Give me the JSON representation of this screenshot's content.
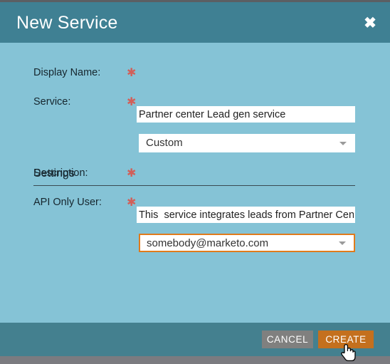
{
  "dialog": {
    "title": "New Service",
    "close_icon": "close-icon"
  },
  "colors": {
    "titlebar": "#3f8093",
    "body": "#85c3d6",
    "footer": "#44808f",
    "required_star": "#d1605a",
    "focus_border": "#e07b1c",
    "cancel_button": "#80807f",
    "create_button": "#c4701e",
    "bottom_strip": "#7b7b80"
  },
  "form": {
    "required_marker": "✱",
    "fields": [
      {
        "label": "Display Name:",
        "type": "text",
        "value": "Partner center Lead gen service",
        "placeholder": "",
        "required": true,
        "focused": false
      },
      {
        "label": "Service:",
        "type": "select",
        "value": "Custom",
        "required": true,
        "focused": false,
        "caret_icon": "chevron-down-icon"
      },
      {
        "label": "Description:",
        "type": "text",
        "value": "This  service integrates leads from Partner Center",
        "placeholder": "",
        "required": true,
        "focused": false
      },
      {
        "label": "API Only User:",
        "type": "select",
        "value": "somebody@marketo.com",
        "required": true,
        "focused": true,
        "caret_icon": "chevron-down-icon"
      }
    ]
  },
  "section": {
    "heading": "Settings"
  },
  "footer": {
    "cancel_label": "CANCEL",
    "create_label": "CREATE"
  },
  "cursor": {
    "icon": "pointing-hand-cursor"
  }
}
